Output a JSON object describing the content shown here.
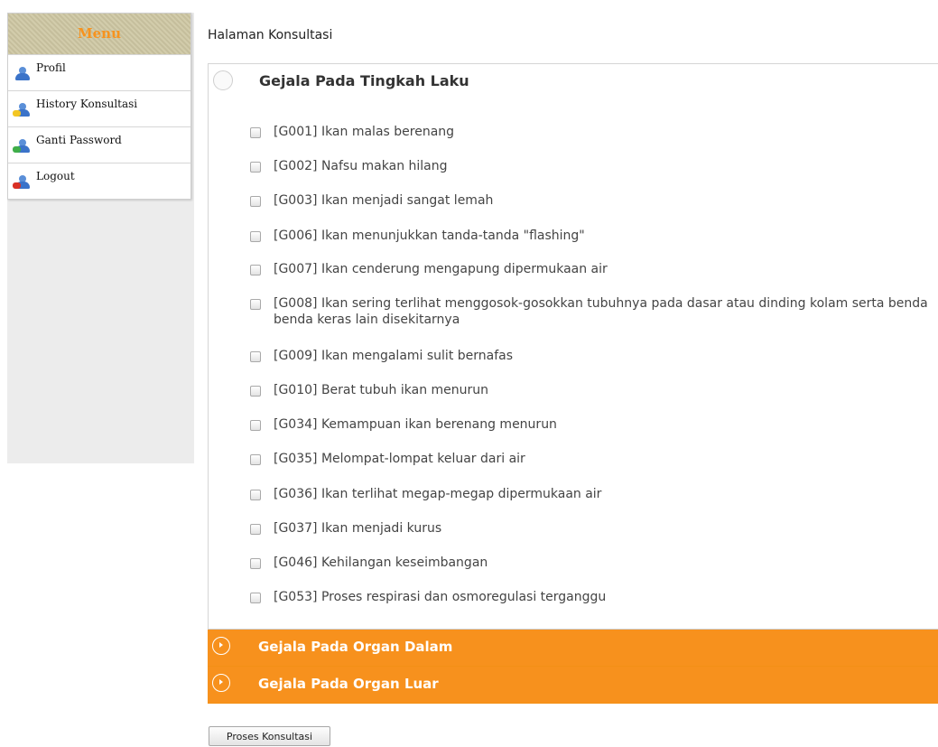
{
  "sidebar": {
    "title": "Menu",
    "items": [
      {
        "label": "Profil",
        "icon": "user-icon"
      },
      {
        "label": "History Konsultasi",
        "icon": "user-history-icon"
      },
      {
        "label": "Ganti Password",
        "icon": "user-add-icon"
      },
      {
        "label": "Logout",
        "icon": "user-remove-icon"
      }
    ]
  },
  "page": {
    "title": "Halaman Konsultasi"
  },
  "accordion": {
    "open_section": {
      "title": "Gejala Pada Tingkah Laku",
      "symptoms": [
        "[G001] Ikan malas berenang",
        "[G002] Nafsu makan hilang",
        "[G003] Ikan menjadi sangat lemah",
        "[G006] Ikan menunjukkan tanda-tanda \"flashing\"",
        "[G007] Ikan cenderung mengapung dipermukaan air",
        "[G008] Ikan sering terlihat menggosok-gosokkan tubuhnya pada dasar atau dinding kolam serta benda benda keras lain disekitarnya",
        "[G009] Ikan mengalami sulit bernafas",
        "[G010] Berat tubuh ikan menurun",
        "[G034] Kemampuan ikan berenang menurun",
        "[G035] Melompat-lompat keluar dari air",
        "[G036] Ikan terlihat megap-megap dipermukaan air",
        "[G037] Ikan menjadi kurus",
        "[G046] Kehilangan keseimbangan",
        "[G053] Proses respirasi dan osmoregulasi terganggu"
      ]
    },
    "closed_sections": [
      {
        "title": "Gejala Pada Organ Dalam"
      },
      {
        "title": "Gejala Pada Organ Luar"
      }
    ]
  },
  "actions": {
    "submit_label": "Proses Konsultasi"
  },
  "colors": {
    "accent": "#f7911d",
    "menu_header": "#cdc6a2",
    "menu_title": "#f7931e"
  }
}
